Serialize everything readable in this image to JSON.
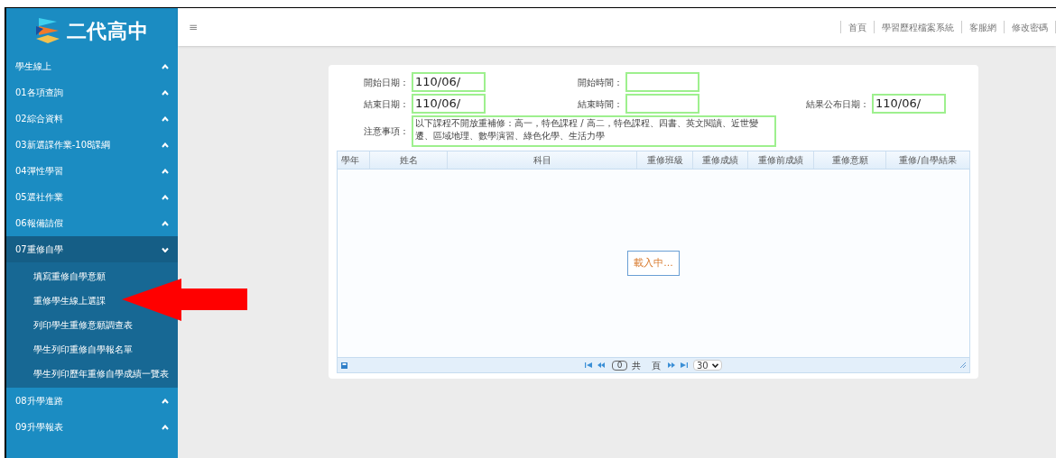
{
  "logo": {
    "text": "二代高中"
  },
  "sidebar": {
    "items": [
      {
        "label": "學生線上",
        "expanded": false
      },
      {
        "label": "01各項查詢",
        "expanded": false
      },
      {
        "label": "02綜合資料",
        "expanded": false
      },
      {
        "label": "03新選課作業-108課綱",
        "expanded": false
      },
      {
        "label": "04彈性學習",
        "expanded": false
      },
      {
        "label": "05選社作業",
        "expanded": false
      },
      {
        "label": "06報備請假",
        "expanded": false
      },
      {
        "label": "07重修自學",
        "expanded": true,
        "children": [
          {
            "label": "填寫重修自學意願"
          },
          {
            "label": "重修學生線上選課"
          },
          {
            "label": "列印學生重修意願調查表"
          },
          {
            "label": "學生列印重修自學報名單"
          },
          {
            "label": "學生列印歷年重修自學成績一覽表"
          }
        ]
      },
      {
        "label": "08升學進路",
        "expanded": false
      },
      {
        "label": "09升學報表",
        "expanded": false
      }
    ]
  },
  "header": {
    "menu_icon": "≡",
    "links": [
      "首頁",
      "學習歷程檔案系統",
      "客服網",
      "修改密碼"
    ]
  },
  "form": {
    "rows": [
      [
        {
          "label": "開始日期：",
          "value": "110/06/"
        },
        {
          "label": "開始時間："
        }
      ],
      [
        {
          "label": "結束日期：",
          "value": "110/06/"
        },
        {
          "label": "結束時間："
        },
        {
          "label": "結果公布日期：",
          "value": "110/06/"
        }
      ]
    ],
    "notes": {
      "label": "注意事項：",
      "value": "以下課程不開放重補修：高一，特色課程 / 高二，特色課程、四書、英文閱讀、近世變遷、區域地理、數學演習、綠色化學、生活力學"
    }
  },
  "grid": {
    "columns": [
      "學年",
      "姓名",
      "科目",
      "重修班級",
      "重修成績",
      "重修前成績",
      "重修意願",
      "重修/自學結果"
    ],
    "loading": "載入中...",
    "pager": {
      "page": "0",
      "total_label": "共",
      "page_label": "頁",
      "page_size": "30"
    }
  }
}
